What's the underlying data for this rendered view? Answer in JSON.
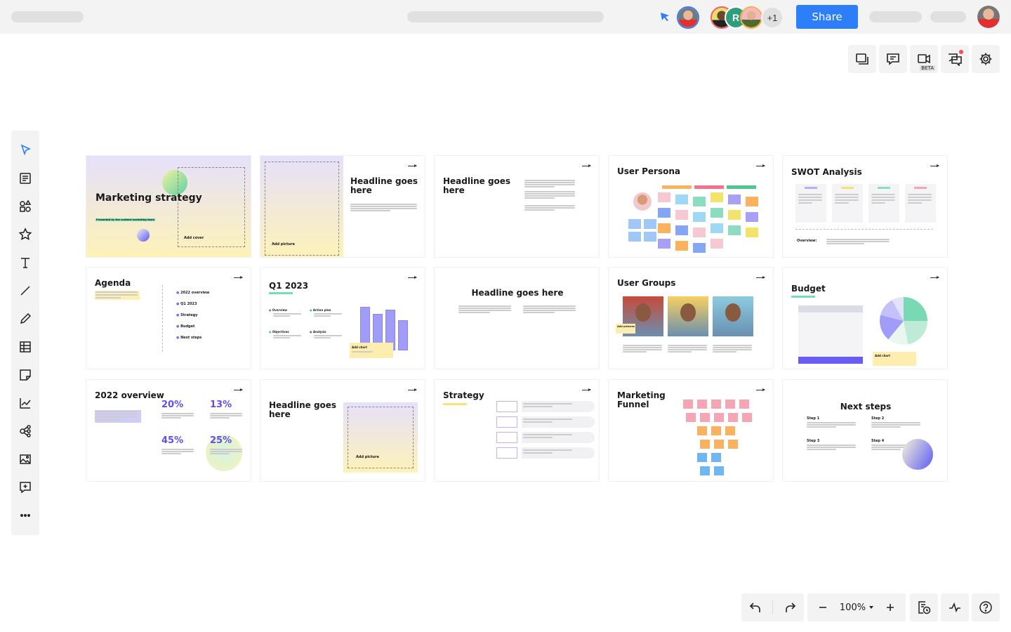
{
  "topbar": {
    "share_label": "Share",
    "collaborator_initial": "R",
    "extra_collaborators": "+1",
    "accent": "#2d7ff9"
  },
  "right_tools": [
    {
      "icon": "frames-icon"
    },
    {
      "icon": "comment-icon"
    },
    {
      "icon": "video-icon",
      "badge": "BETA"
    },
    {
      "icon": "chat-icon",
      "notification": true
    },
    {
      "icon": "settings-icon"
    }
  ],
  "left_tools": [
    "select-icon",
    "template-icon",
    "shapes-icon",
    "star-icon",
    "text-icon",
    "line-icon",
    "pen-icon",
    "table-icon",
    "sticky-note-icon",
    "chart-icon",
    "mindmap-icon",
    "image-icon",
    "comment-add-icon",
    "more-icon"
  ],
  "bottom": {
    "zoom": "100%"
  },
  "slides": {
    "s1": {
      "title": "Marketing strategy",
      "subtitle": "Presented by the content marketing team",
      "add": "Add cover"
    },
    "s2": {
      "title": "Headline goes here",
      "add": "Add picture"
    },
    "s3": {
      "title": "Headline goes here"
    },
    "s4": {
      "title": "User Persona"
    },
    "s5": {
      "title": "SWOT Analysis",
      "overview": "Overview:"
    },
    "s6": {
      "title": "Agenda",
      "items": [
        "2022 overview",
        "Q1 2023",
        "Strategy",
        "Budget",
        "Next steps"
      ]
    },
    "s7": {
      "title": "Q1 2023",
      "items": [
        "Overview",
        "Action plan",
        "Objectives",
        "Analysis"
      ],
      "add": "Add chart",
      "bars": [
        78,
        65,
        72,
        54
      ]
    },
    "s8": {
      "title": "Headline goes here"
    },
    "s9": {
      "title": "User Groups",
      "add": "Add pictures"
    },
    "s10": {
      "title": "Budget",
      "add": "Add chart",
      "pie": [
        25,
        22,
        14,
        18,
        13,
        8
      ]
    },
    "s11": {
      "title": "2022 overview",
      "stats": [
        "20%",
        "13%",
        "45%",
        "25%"
      ]
    },
    "s12": {
      "title": "Headline goes here",
      "add": "Add picture"
    },
    "s13": {
      "title": "Strategy"
    },
    "s14": {
      "title": "Marketing Funnel"
    },
    "s15": {
      "title": "Next steps",
      "steps": [
        "Step 1",
        "Step 2",
        "Step 3",
        "Step 4"
      ]
    }
  }
}
